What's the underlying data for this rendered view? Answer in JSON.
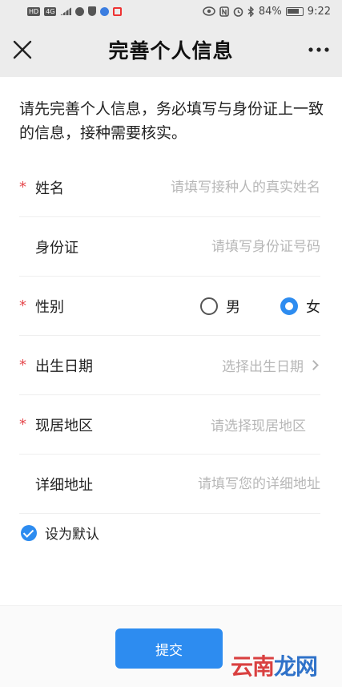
{
  "status_bar": {
    "left_labels": [
      "HD",
      "4G"
    ],
    "battery": "84%",
    "time": "9:22",
    "icons": [
      "hd-icon",
      "signal-icon",
      "message-icon",
      "shield-icon",
      "browser-icon",
      "app-icon",
      "eye-icon",
      "nfc-icon",
      "alarm-icon",
      "bluetooth-icon",
      "battery-icon"
    ]
  },
  "nav": {
    "title": "完善个人信息",
    "close_icon": "close-icon",
    "more_icon": "more-icon"
  },
  "intro": "请先完善个人信息，务必填写与身份证上一致的信息，接种需要核实。",
  "form": {
    "name": {
      "label": "姓名",
      "required": "*",
      "placeholder": "请填写接种人的真实姓名",
      "value": ""
    },
    "id_card": {
      "label": "身份证",
      "placeholder": "请填写身份证号码",
      "value": ""
    },
    "gender": {
      "label": "性别",
      "required": "*",
      "options": [
        "男",
        "女"
      ],
      "selected": "女"
    },
    "birthday": {
      "label": "出生日期",
      "required": "*",
      "placeholder": "选择出生日期"
    },
    "region": {
      "label": "现居地区",
      "required": "*",
      "placeholder": "请选择现居地区"
    },
    "address": {
      "label": "详细地址",
      "placeholder": "请填写您的详细地址",
      "value": ""
    }
  },
  "default_toggle": {
    "label": "设为默认",
    "checked": true
  },
  "submit_label": "提交",
  "watermark": {
    "part1": "云南",
    "part2": "龙网"
  },
  "colors": {
    "accent": "#2d8cf0",
    "required": "#e5484d",
    "header_bg": "#ececec"
  }
}
